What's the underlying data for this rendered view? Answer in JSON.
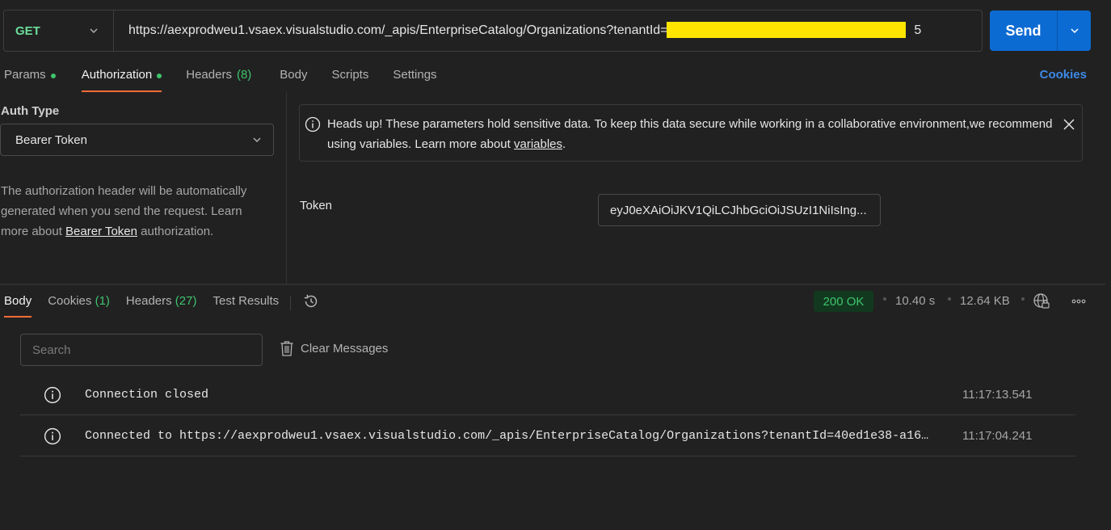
{
  "request": {
    "method": "GET",
    "url": "https://aexprodweu1.vsaex.visualstudio.com/_apis/EnterpriseCatalog/Organizations?tenantId=4",
    "url_tail": "5",
    "send_label": "Send"
  },
  "request_tabs": [
    {
      "label": "Params",
      "dot": true
    },
    {
      "label": "Authorization",
      "dot": true
    },
    {
      "label": "Headers",
      "count": "(8)"
    },
    {
      "label": "Body"
    },
    {
      "label": "Scripts"
    },
    {
      "label": "Settings"
    }
  ],
  "cookies_link": "Cookies",
  "auth": {
    "type_label": "Auth Type",
    "type_value": "Bearer Token",
    "desc_before": "The authorization header will be automatically generated when you send the request. Learn more about ",
    "desc_link": "Bearer Token",
    "desc_after": " authorization."
  },
  "notice": {
    "text": "Heads up! These parameters hold sensitive data. To keep this data secure while working in a collaborative environment,we recommend using variables. Learn more about ",
    "link": "variables",
    "end": "."
  },
  "token": {
    "label": "Token",
    "value": "eyJ0eXAiOiJKV1QiLCJhbGciOiJSUzI1NiIsIng..."
  },
  "response_tabs": [
    {
      "label": "Body",
      "count": ""
    },
    {
      "label": "Cookies",
      "count": "(1)"
    },
    {
      "label": "Headers",
      "count": "(27)"
    },
    {
      "label": "Test Results",
      "count": ""
    }
  ],
  "response": {
    "status": "200 OK",
    "time": "10.40 s",
    "size": "12.64 KB"
  },
  "messages": {
    "search_placeholder": "Search",
    "clear_label": "Clear Messages",
    "items": [
      {
        "text": "Connection closed",
        "time": "11:17:13.541"
      },
      {
        "text": "Connected to https://aexprodweu1.vsaex.visualstudio.com/_apis/EnterpriseCatalog/Organizations?tenantId=40ed1e38-a16…",
        "time": "11:17:04.241"
      }
    ]
  },
  "colors": {
    "background": "#212121",
    "method": "#6bdd9a",
    "send": "#0c6bd3",
    "active_tab_underline": "#ff6c37",
    "status_green": "#3ec46d",
    "link_blue": "#3d8ae8",
    "redaction": "#ffe500"
  }
}
